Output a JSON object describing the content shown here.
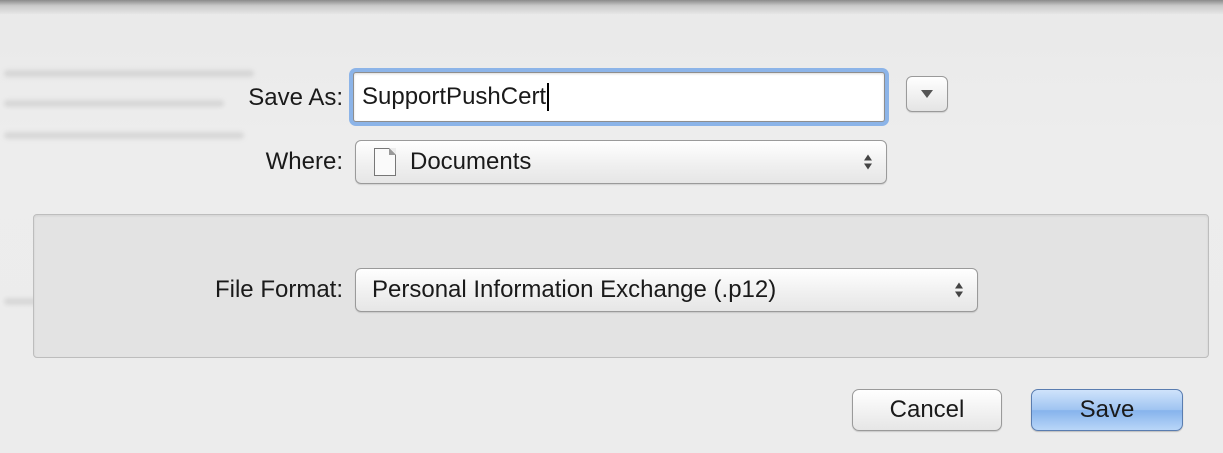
{
  "dialog": {
    "save_as_label": "Save As:",
    "file_name_value": "SupportPushCert",
    "where_label": "Where:",
    "where_value": "Documents",
    "file_format_label": "File Format:",
    "file_format_value": "Personal Information Exchange (.p12)",
    "cancel_label": "Cancel",
    "save_label": "Save"
  },
  "icons": {
    "disclosure": "triangle-down-icon",
    "where_folder": "document-icon",
    "popup_stepper": "up-down-arrows-icon"
  },
  "colors": {
    "focus_ring": "#8cb4e8",
    "default_button": "#9fc4f1",
    "background": "#ececec"
  }
}
